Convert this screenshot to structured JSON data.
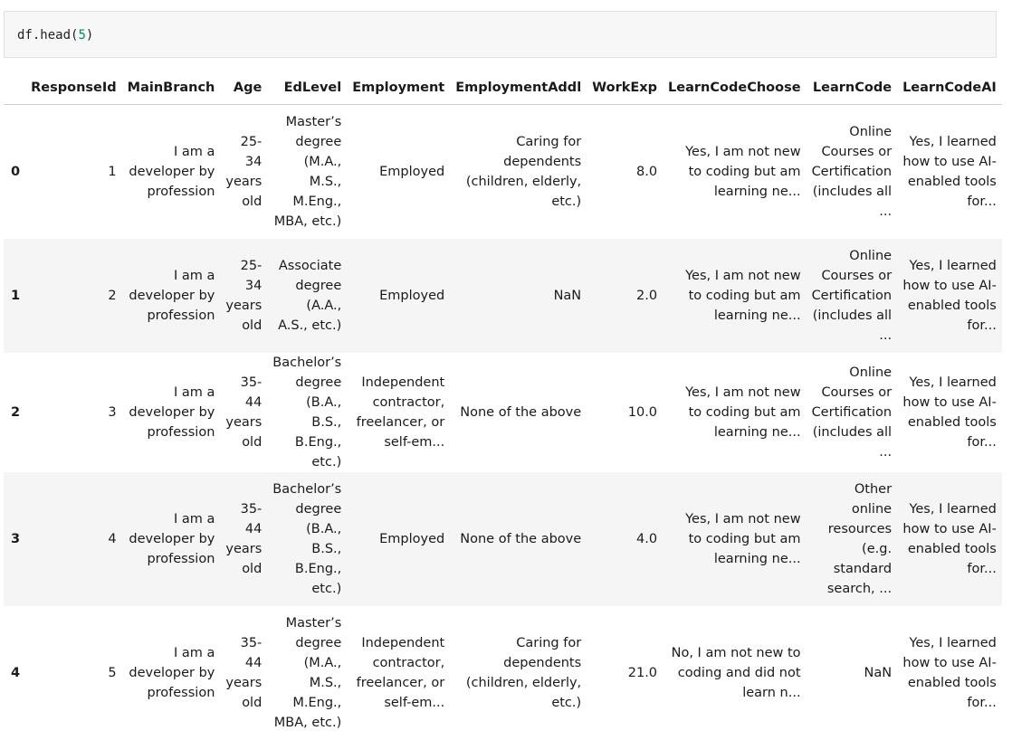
{
  "code_cell": {
    "prefix": "df.head(",
    "argument": "5",
    "suffix": ")"
  },
  "table": {
    "index_header": "",
    "columns": [
      "ResponseId",
      "MainBranch",
      "Age",
      "EdLevel",
      "Employment",
      "EmploymentAddl",
      "WorkExp",
      "LearnCodeChoose",
      "LearnCode",
      "LearnCodeAI"
    ],
    "rows": [
      {
        "index": "0",
        "cells": [
          "1",
          "I am a developer by profession",
          "25-34 years old",
          "Master’s degree (M.A., M.S., M.Eng., MBA, etc.)",
          "Employed",
          "Caring for dependents (children, elderly, etc.)",
          "8.0",
          "Yes, I am not new to coding but am learning ne...",
          "Online Courses or Certification (includes all ...",
          "Yes, I learned how to use AI-enabled tools for..."
        ]
      },
      {
        "index": "1",
        "cells": [
          "2",
          "I am a developer by profession",
          "25-34 years old",
          "Associate degree (A.A., A.S., etc.)",
          "Employed",
          "NaN",
          "2.0",
          "Yes, I am not new to coding but am learning ne...",
          "Online Courses or Certification (includes all ...",
          "Yes, I learned how to use AI-enabled tools for..."
        ]
      },
      {
        "index": "2",
        "cells": [
          "3",
          "I am a developer by profession",
          "35-44 years old",
          "Bachelor’s degree (B.A., B.S., B.Eng., etc.)",
          "Independent contractor, freelancer, or self-em...",
          "None of the above",
          "10.0",
          "Yes, I am not new to coding but am learning ne...",
          "Online Courses or Certification (includes all ...",
          "Yes, I learned how to use AI-enabled tools for..."
        ]
      },
      {
        "index": "3",
        "cells": [
          "4",
          "I am a developer by profession",
          "35-44 years old",
          "Bachelor’s degree (B.A., B.S., B.Eng., etc.)",
          "Employed",
          "None of the above",
          "4.0",
          "Yes, I am not new to coding but am learning ne...",
          "Other online resources (e.g. standard search, ...",
          "Yes, I learned how to use AI-enabled tools for..."
        ]
      },
      {
        "index": "4",
        "cells": [
          "5",
          "I am a developer by profession",
          "35-44 years old",
          "Master’s degree (M.A., M.S., M.Eng., MBA, etc.)",
          "Independent contractor, freelancer, or self-em...",
          "Caring for dependents (children, elderly, etc.)",
          "21.0",
          "No, I am not new to coding and did not learn n...",
          "NaN",
          "Yes, I learned how to use AI-enabled tools for..."
        ]
      }
    ]
  }
}
